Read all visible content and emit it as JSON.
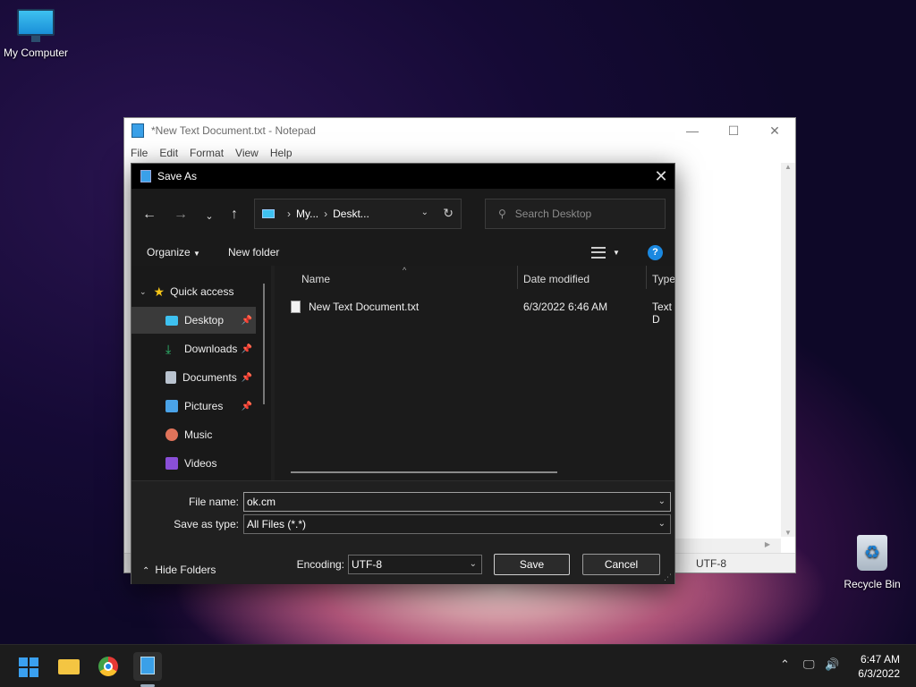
{
  "desktop": {
    "icons": [
      {
        "label": "My Computer"
      },
      {
        "label": "Recycle Bin"
      }
    ]
  },
  "notepad": {
    "title": "*New Text Document.txt - Notepad",
    "menu": [
      "File",
      "Edit",
      "Format",
      "View",
      "Help"
    ],
    "status_encoding": "UTF-8"
  },
  "dialog": {
    "title": "Save As",
    "address": {
      "part1": "My...",
      "part2": "Deskt..."
    },
    "search": {
      "placeholder": "Search Desktop"
    },
    "toolbar": {
      "organize": "Organize",
      "new_folder": "New folder"
    },
    "sidebar": {
      "quick_access": "Quick access",
      "items": [
        {
          "label": "Desktop",
          "color": "#3ec1f0",
          "pinned": true
        },
        {
          "label": "Downloads",
          "color": "#2fbf71",
          "pinned": true
        },
        {
          "label": "Documents",
          "color": "#b9c3cf",
          "pinned": true
        },
        {
          "label": "Pictures",
          "color": "#4aa3e8",
          "pinned": true
        },
        {
          "label": "Music",
          "color": "#e0735a",
          "pinned": false
        },
        {
          "label": "Videos",
          "color": "#8a4fd8",
          "pinned": false
        }
      ]
    },
    "columns": {
      "name": "Name",
      "date": "Date modified",
      "type": "Type"
    },
    "files": [
      {
        "name": "New Text Document.txt",
        "date": "6/3/2022 6:46 AM",
        "type": "Text D"
      }
    ],
    "file_name": {
      "label": "File name:",
      "value": "ok.cm"
    },
    "save_type": {
      "label": "Save as type:",
      "value": "All Files  (*.*)"
    },
    "encoding": {
      "label": "Encoding:",
      "value": "UTF-8"
    },
    "save_label": "Save",
    "cancel_label": "Cancel",
    "hide_folders": "Hide Folders"
  },
  "taskbar": {
    "time": "6:47 AM",
    "date": "6/3/2022"
  }
}
